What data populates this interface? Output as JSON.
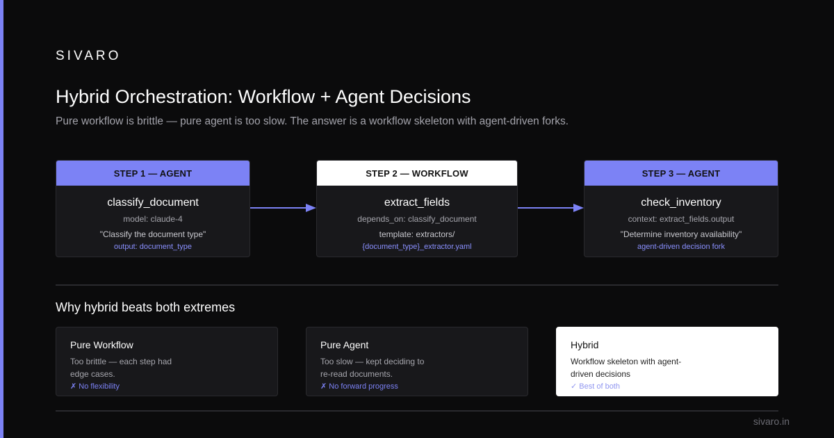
{
  "brand": "SIVARO",
  "title": "Hybrid Orchestration: Workflow + Agent Decisions",
  "subtitle": "Pure workflow is brittle — pure agent is too slow. The answer is a workflow skeleton with agent-driven forks.",
  "colors": {
    "accent": "#7c82f5",
    "background": "#0b0b0c",
    "card": "#18181b",
    "link": "#8a90ff"
  },
  "steps": [
    {
      "header": "STEP 1 — AGENT",
      "kind": "agent",
      "name": "classify_document",
      "meta": "model: claude-4",
      "quote": "\"Classify the document type\"",
      "output": "output: document_type"
    },
    {
      "header": "STEP 2 — WORKFLOW",
      "kind": "workflow",
      "name": "extract_fields",
      "meta": "depends_on: classify_document",
      "quote": "template: extractors/",
      "output": "{document_type}_extractor.yaml"
    },
    {
      "header": "STEP 3 — AGENT",
      "kind": "agent",
      "name": "check_inventory",
      "meta": "context: extract_fields.output",
      "quote": "\"Determine inventory availability\"",
      "output": "agent-driven decision fork"
    }
  ],
  "section_title": "Why hybrid beats both extremes",
  "cards": [
    {
      "title": "Pure Workflow",
      "body": "Too brittle — each step had edge cases.",
      "note": "✗ No flexibility"
    },
    {
      "title": "Pure Agent",
      "body": "Too slow — kept deciding to re-read documents.",
      "note": "✗ No forward progress"
    },
    {
      "title": "Hybrid",
      "body": "Workflow skeleton with agent-driven decisions",
      "note": "✓ Best of both"
    }
  ],
  "footer": "sivaro.in"
}
